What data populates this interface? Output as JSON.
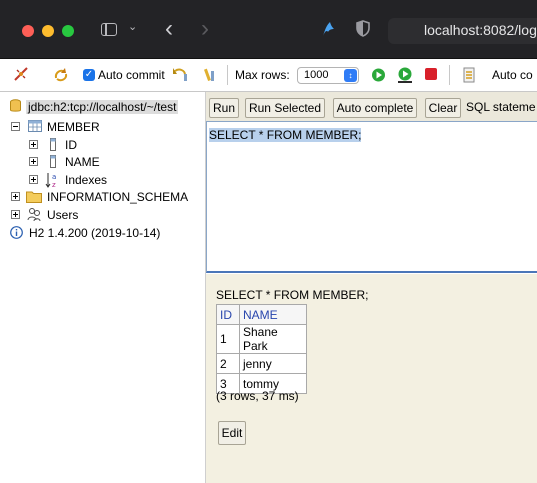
{
  "browser": {
    "url": "localhost:8082/logi"
  },
  "toolbar": {
    "auto_commit_label": "Auto commit",
    "max_rows_label": "Max rows:",
    "max_rows_value": "1000",
    "auto_complete_label": "Auto co"
  },
  "tree": {
    "connection": "jdbc:h2:tcp://localhost/~/test",
    "table": "MEMBER",
    "columns": [
      "ID",
      "NAME"
    ],
    "indexes": "Indexes",
    "info_schema": "INFORMATION_SCHEMA",
    "users": "Users",
    "version": "H2 1.4.200 (2019-10-14)"
  },
  "query": {
    "run": "Run",
    "run_selected": "Run Selected",
    "auto_complete": "Auto complete",
    "clear": "Clear",
    "sql_label": "SQL stateme",
    "sql_text": "SELECT * FROM MEMBER;"
  },
  "result": {
    "sql": "SELECT * FROM MEMBER;",
    "headers": [
      "ID",
      "NAME"
    ],
    "rows": [
      [
        "1",
        "Shane Park"
      ],
      [
        "2",
        "jenny"
      ],
      [
        "3",
        "tommy"
      ]
    ],
    "info": "(3 rows, 37 ms)",
    "edit": "Edit"
  },
  "colors": {
    "chrome_bg": "#232326",
    "panel_bg": "#f3f0e1",
    "header_link": "#2845ad",
    "selection": "#b8d0ec"
  }
}
